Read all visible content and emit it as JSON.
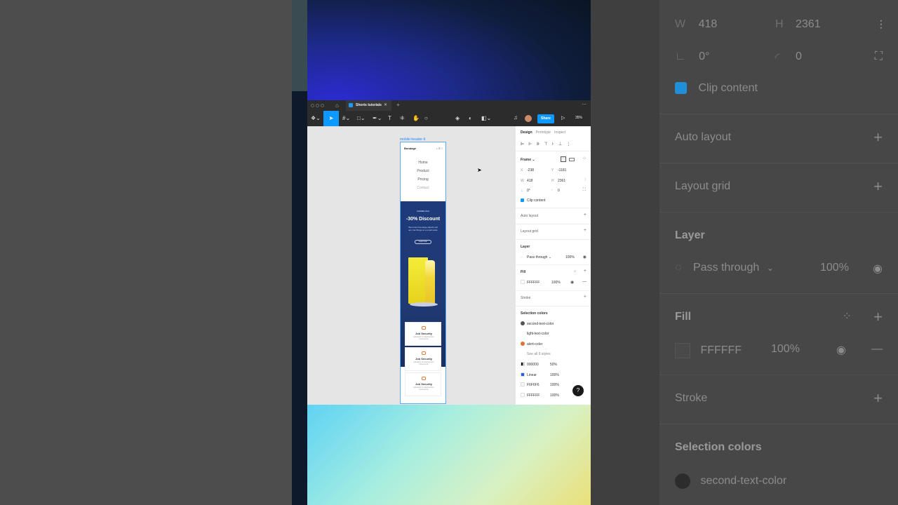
{
  "background_panel": {
    "w_label": "W",
    "w_value": "418",
    "h_label": "H",
    "h_value": "2361",
    "rotation": "0°",
    "radius": "0",
    "clip_content": "Clip content",
    "auto_layout": "Auto layout",
    "layout_grid": "Layout grid",
    "layer": "Layer",
    "blend": "Pass through",
    "opacity": "100%",
    "fill": "Fill",
    "fill_hex": "FFFFFF",
    "fill_opacity": "100%",
    "stroke": "Stroke",
    "selection_colors": "Selection colors",
    "color1": "second-text-color"
  },
  "figma": {
    "tab_name": "Shorts tutorials",
    "share_label": "Share",
    "zoom": "35%",
    "frame_label": "mobile-header-6",
    "mockup": {
      "brand": "Bondage",
      "nav": [
        "Home",
        "Product",
        "Pricing",
        "Contact"
      ],
      "kicker": "SUMMER 2022",
      "title": "-30% Discount",
      "body": "We know how large objects will act, but things on a small scale",
      "cta": "Learn more",
      "cards": [
        {
          "title": "Job Security",
          "body": "Education of industries and business life"
        },
        {
          "title": "Job Security",
          "body": "Education of industries and business life"
        },
        {
          "title": "Job Security",
          "body": "Education of industries and business life"
        }
      ]
    },
    "props": {
      "tabs": [
        "Design",
        "Prototype",
        "Inspect"
      ],
      "frame": "Frame",
      "x_label": "X",
      "x_value": "-238",
      "y_label": "Y",
      "y_value": "-1181",
      "w_label": "W",
      "w_value": "418",
      "h_label": "H",
      "h_value": "2361",
      "rotation": "0°",
      "radius": "0",
      "clip_content": "Clip content",
      "auto_layout": "Auto layout",
      "layout_grid": "Layout grid",
      "layer": "Layer",
      "blend": "Pass through",
      "opacity": "100%",
      "fill": "Fill",
      "fill_hex": "FFFFFF",
      "fill_opacity": "100%",
      "stroke": "Stroke",
      "selection_colors": "Selection colors",
      "colors": [
        {
          "name": "second-text-color",
          "color": "#555555"
        },
        {
          "name": "light-text-color",
          "color": "#ffffff"
        },
        {
          "name": "alert-color",
          "color": "#e0703a"
        }
      ],
      "see_all": "See all 9 styles",
      "swatches": [
        {
          "hex": "000000",
          "pct": "50%",
          "color": "#000000"
        },
        {
          "hex": "Linear",
          "pct": "100%",
          "color": "#2d5ae0"
        },
        {
          "hex": "F6F6F6",
          "pct": "100%",
          "color": "#f6f6f6"
        },
        {
          "hex": "FFFFFF",
          "pct": "100%",
          "color": "#ffffff"
        }
      ],
      "help": "?"
    }
  }
}
